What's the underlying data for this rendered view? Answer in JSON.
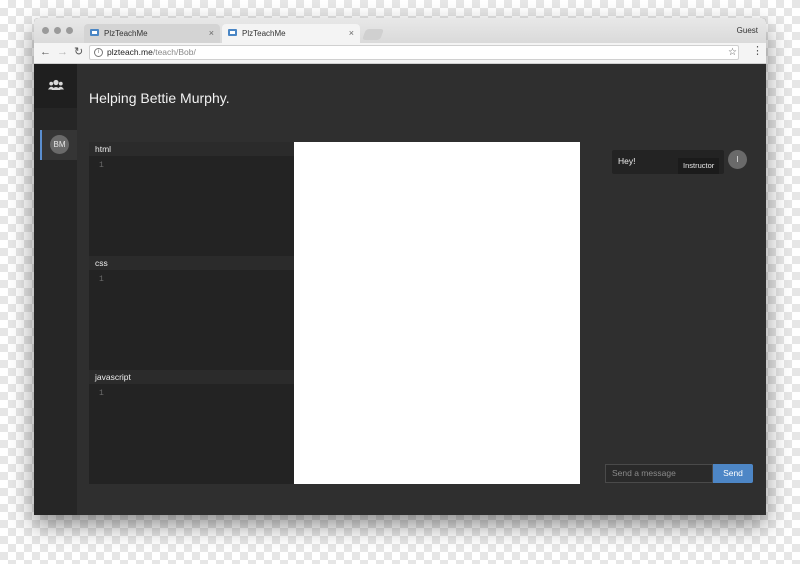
{
  "browser": {
    "tabs": [
      {
        "title": "PlzTeachMe",
        "close": "×"
      },
      {
        "title": "PlzTeachMe",
        "close": "×"
      }
    ],
    "profile": "Guest",
    "url_host": "plzteach.me",
    "url_path": "/teach/Bob/",
    "nav": {
      "back": "←",
      "forward": "→",
      "reload": "↻",
      "star": "☆",
      "menu": "⋮"
    }
  },
  "sidebar": {
    "students": [
      {
        "initials": "BM"
      }
    ]
  },
  "main": {
    "heading": "Helping Bettie Murphy.",
    "editors": [
      {
        "label": "html",
        "line": "1"
      },
      {
        "label": "css",
        "line": "1"
      },
      {
        "label": "javascript",
        "line": "1"
      }
    ]
  },
  "chat": {
    "messages": [
      {
        "text": "Hey!",
        "role": "Instructor",
        "avatar": "I"
      }
    ],
    "input_placeholder": "Send a message",
    "send_label": "Send"
  },
  "colors": {
    "accent": "#4d86c6",
    "background": "#2f2f2f",
    "preview": "#ffffff"
  }
}
